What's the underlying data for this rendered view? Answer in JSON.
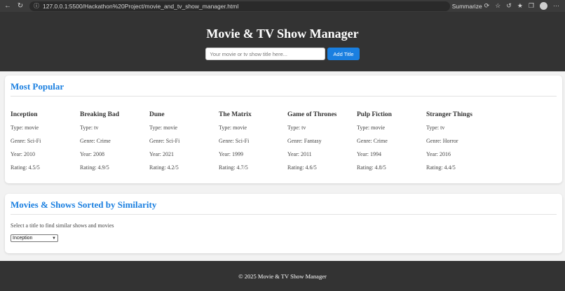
{
  "browser": {
    "url": "127.0.0.1:5500/Hackathon%20Project/movie_and_tv_show_manager.html",
    "summarize_label": "Summarize",
    "back_icon": "back-arrow-icon",
    "reload_icon": "reload-icon"
  },
  "header": {
    "title": "Movie & TV Show Manager",
    "input_placeholder": "Your movie or tv show title here...",
    "add_button_label": "Add Title"
  },
  "popular": {
    "title": "Most Popular",
    "items": [
      {
        "name": "Inception",
        "type": "Type: movie",
        "genre": "Genre: Sci-Fi",
        "year": "Year: 2010",
        "rating": "Rating: 4.5/5"
      },
      {
        "name": "Breaking Bad",
        "type": "Type: tv",
        "genre": "Genre: Crime",
        "year": "Year: 2008",
        "rating": "Rating: 4.9/5"
      },
      {
        "name": "Dune",
        "type": "Type: movie",
        "genre": "Genre: Sci-Fi",
        "year": "Year: 2021",
        "rating": "Rating: 4.2/5"
      },
      {
        "name": "The Matrix",
        "type": "Type: movie",
        "genre": "Genre: Sci-Fi",
        "year": "Year: 1999",
        "rating": "Rating: 4.7/5"
      },
      {
        "name": "Game of Thrones",
        "type": "Type: tv",
        "genre": "Genre: Fantasy",
        "year": "Year: 2011",
        "rating": "Rating: 4.6/5"
      },
      {
        "name": "Pulp Fiction",
        "type": "Type: movie",
        "genre": "Genre: Crime",
        "year": "Year: 1994",
        "rating": "Rating: 4.8/5"
      },
      {
        "name": "Stranger Things",
        "type": "Type: tv",
        "genre": "Genre: Horror",
        "year": "Year: 2016",
        "rating": "Rating: 4.4/5"
      }
    ]
  },
  "similar": {
    "title": "Movies & Shows Sorted by Similarity",
    "hint": "Select a title to find similar shows and movies",
    "selected": "Inception"
  },
  "footer": {
    "text": "© 2025 Movie & TV Show Manager"
  },
  "colors": {
    "accent": "#1a7fe0",
    "header_bg": "#333333",
    "page_bg": "#f2f2f2"
  }
}
